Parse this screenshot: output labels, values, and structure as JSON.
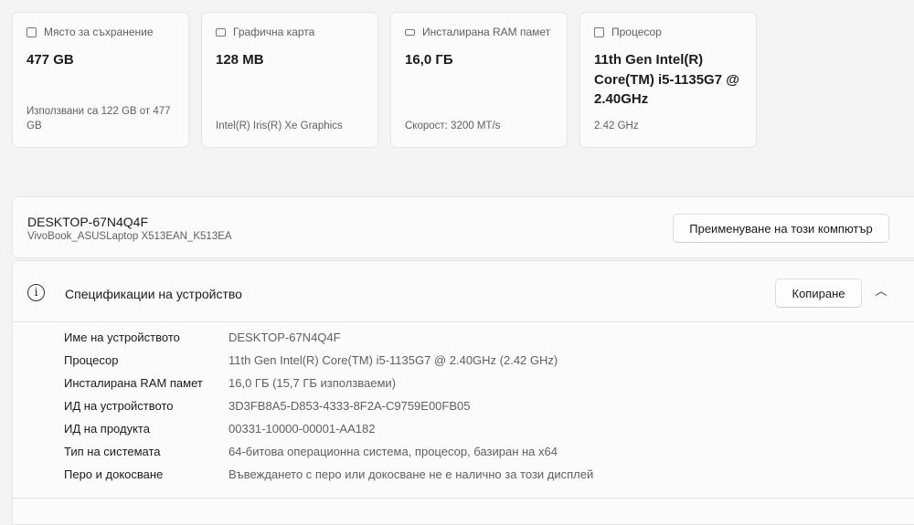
{
  "cards": [
    {
      "icon": "storage-icon",
      "title": "Място за съхранение",
      "value": "477 GB",
      "sub": "Използвани са 122 GB от 477 GB"
    },
    {
      "icon": "graphics-card-icon",
      "title": "Графична карта",
      "value": "128 MB",
      "sub": "Intel(R) Iris(R) Xe Graphics"
    },
    {
      "icon": "ram-icon",
      "title": "Инсталирана RAM памет",
      "value": "16,0 ГБ",
      "sub": "Скорост: 3200 MT/s"
    },
    {
      "icon": "processor-icon",
      "title": "Процесор",
      "value": "11th Gen Intel(R) Core(TM) i5-1135G7 @ 2.40GHz",
      "sub": "2.42 GHz"
    }
  ],
  "device": {
    "name": "DESKTOP-67N4Q4F",
    "model": "VivoBook_ASUSLaptop X513EAN_K513EA",
    "rename_label": "Преименуване на този компютър"
  },
  "specs": {
    "title": "Спецификации на устройство",
    "copy_label": "Копиране",
    "rows": [
      {
        "k": "Име на устройството",
        "v": "DESKTOP-67N4Q4F"
      },
      {
        "k": "Процесор",
        "v": "11th Gen Intel(R) Core(TM) i5-1135G7 @ 2.40GHz (2.42 GHz)"
      },
      {
        "k": "Инсталирана RAM памет",
        "v": "16,0 ГБ (15,7 ГБ използваеми)"
      },
      {
        "k": "ИД на устройството",
        "v": "3D3FB8A5-D853-4333-8F2A-C9759E00FB05"
      },
      {
        "k": "ИД на продукта",
        "v": "00331-10000-00001-AA182"
      },
      {
        "k": "Тип на системата",
        "v": "64-битова операционна система, процесор, базиран на x64"
      },
      {
        "k": "Перо и докосване",
        "v": "Въвеждането с перо или докосване не е налично за този дисплей"
      }
    ]
  }
}
